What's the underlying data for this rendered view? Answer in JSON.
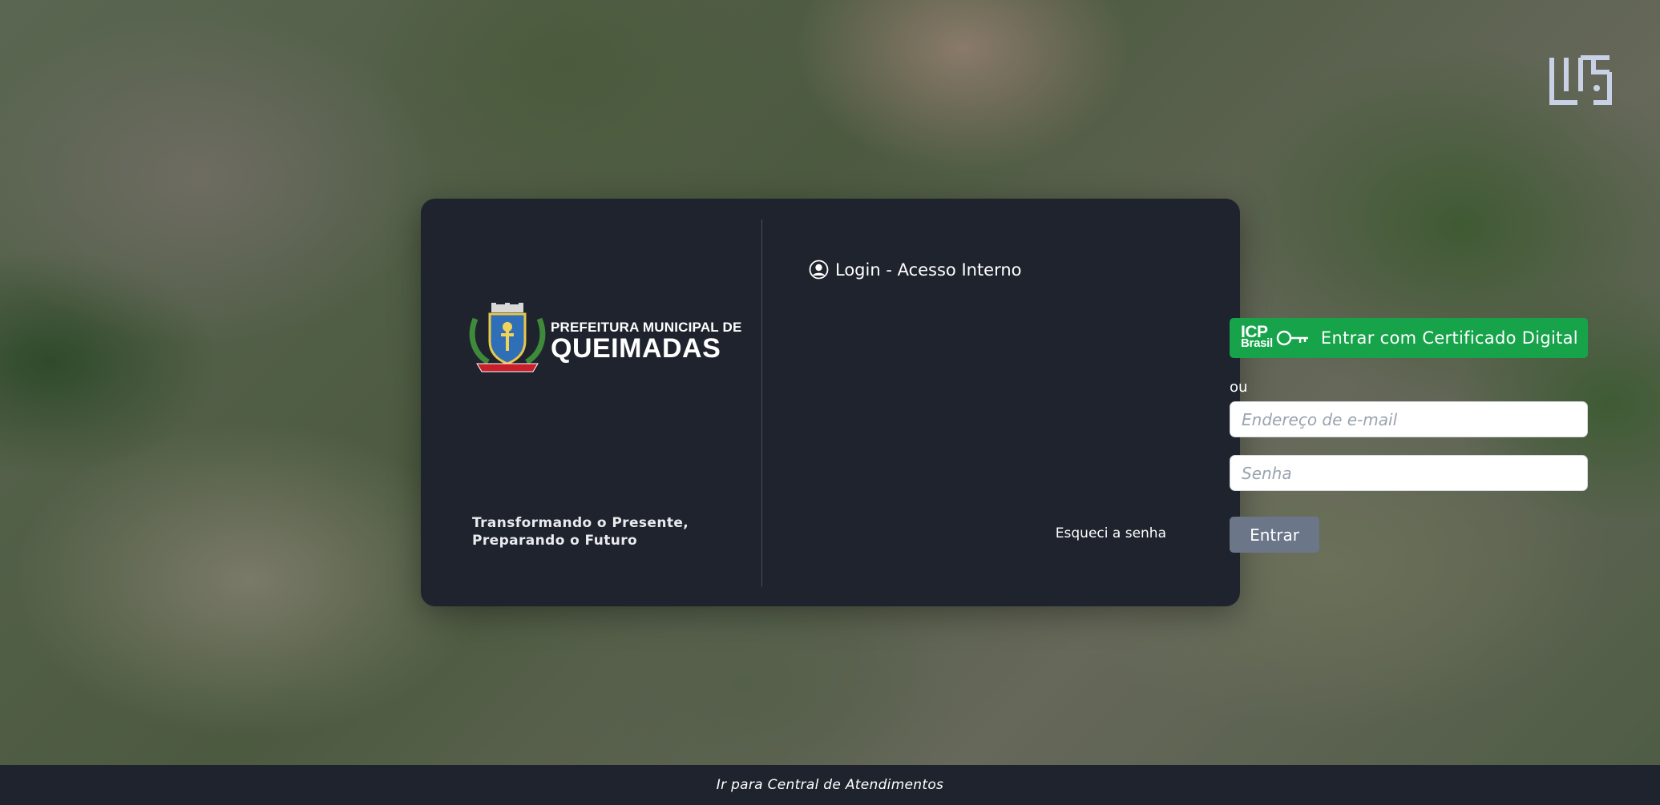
{
  "branding": {
    "corner_logo_icon": "uf-monogram-icon",
    "crest_icon": "municipal-coat-of-arms-icon",
    "city_prefix": "PREFEITURA MUNICIPAL DE",
    "city_name": "QUEIMADAS",
    "slogan_line1": "Transformando o Presente,",
    "slogan_line2": "Preparando o Futuro"
  },
  "login": {
    "title_icon": "user-circle-icon",
    "title": "Login - Acesso Interno",
    "certificate_button": {
      "logo_line1": "ICP",
      "logo_line2": "Brasil",
      "key_icon": "key-icon",
      "label": "Entrar com Certificado Digital"
    },
    "separator": "ou",
    "email_placeholder": "Endereço de e-mail",
    "password_placeholder": "Senha",
    "submit_label": "Entrar",
    "forgot_password": "Esqueci a senha"
  },
  "footer": {
    "link": "Ir para Central de Atendimentos"
  },
  "colors": {
    "card_background": "#1e232d",
    "certificate_green": "#16a34a",
    "submit_gray": "#6b7689",
    "footer_background": "#1e232d"
  }
}
